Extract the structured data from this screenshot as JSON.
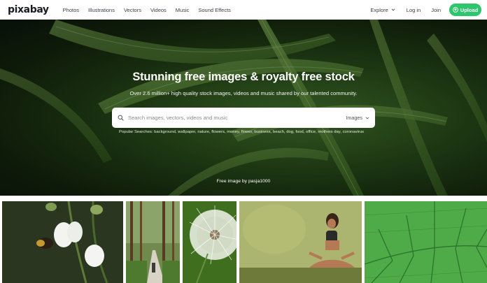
{
  "nav": {
    "logo": "pixabay",
    "links": [
      "Photos",
      "Illustrations",
      "Vectors",
      "Videos",
      "Music",
      "Sound Effects"
    ],
    "explore": "Explore",
    "login": "Log in",
    "join": "Join",
    "upload": "Upload"
  },
  "hero": {
    "title": "Stunning free images & royalty free stock",
    "subtitle": "Over 2.6 million+ high quality stock images, videos and music shared by our talented community.",
    "search_placeholder": "Search images, vectors, videos and music",
    "search_type": "Images",
    "popular_label": "Popular Searches:",
    "popular_terms": "background, wallpaper, nature, flowers, money, flower, business, beach, dog, food, office, mothers day, coronavirus",
    "credit": "Free image by pasja1000"
  },
  "colors": {
    "accent": "#2ec66d",
    "hero_bg": "#1c3412"
  },
  "gallery": [
    {
      "subject": "bee and white bell flowers"
    },
    {
      "subject": "forest path with hiker"
    },
    {
      "subject": "dandelion seed head"
    },
    {
      "subject": "woman meditating outdoors"
    },
    {
      "subject": "green leaf macro"
    }
  ]
}
